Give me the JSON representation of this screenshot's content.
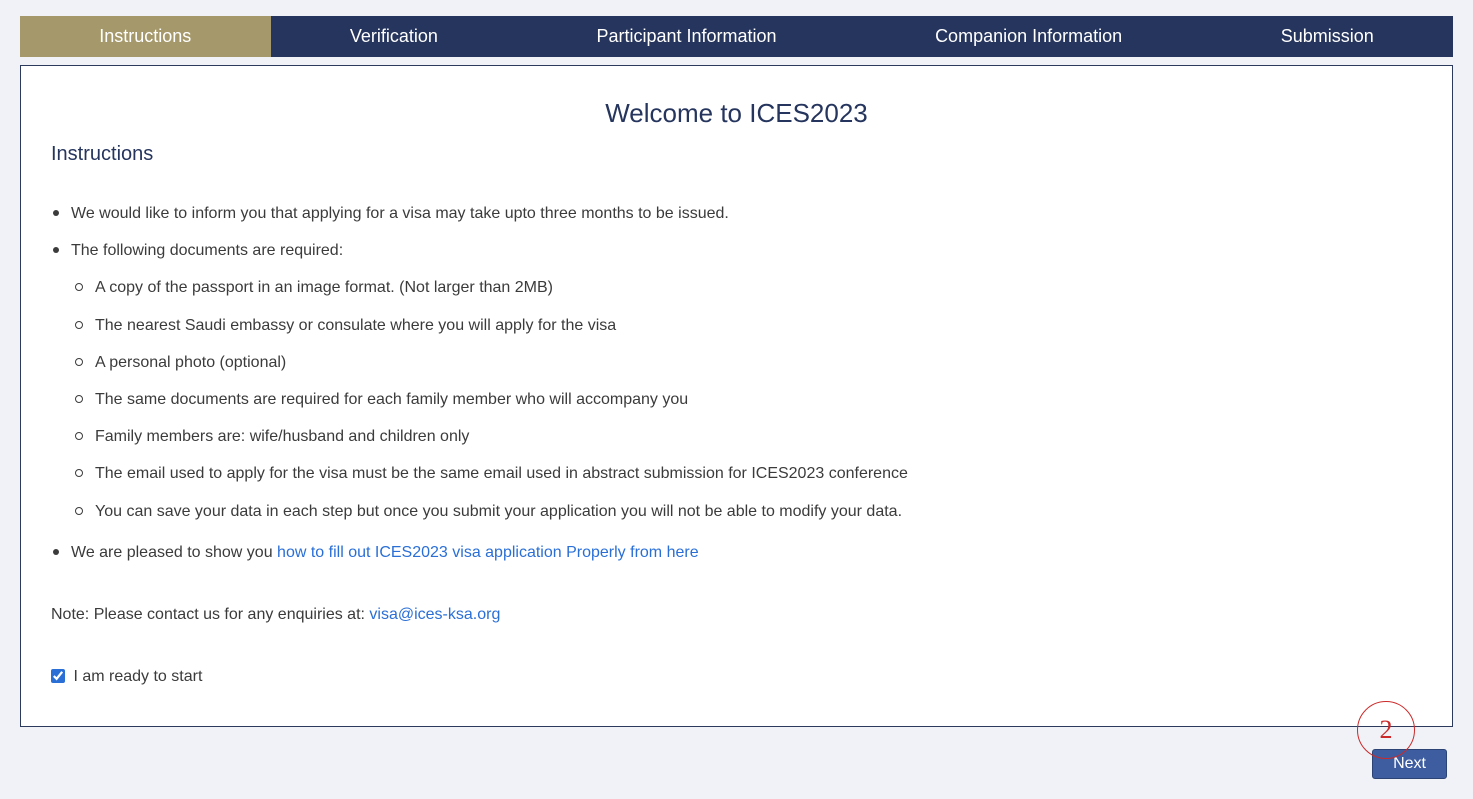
{
  "colors": {
    "navy": "#26355d",
    "gold": "#a5986a",
    "link": "#2a6fd6",
    "btn": "#3d5da0",
    "annotation": "#cc2a2a"
  },
  "tabs": [
    {
      "label": "Instructions",
      "active": true
    },
    {
      "label": "Verification",
      "active": false
    },
    {
      "label": "Participant Information",
      "active": false
    },
    {
      "label": "Companion Information",
      "active": false
    },
    {
      "label": "Submission",
      "active": false
    }
  ],
  "main": {
    "welcome_title": "Welcome to ICES2023",
    "section_title": "Instructions",
    "bullets": {
      "b1": "We would like to inform you that applying for a visa may take upto three months to be issued.",
      "b2": "The following documents are required:",
      "sub": {
        "s1": "A copy of the passport in an image format. (Not larger than 2MB)",
        "s2": "The nearest Saudi embassy or consulate where you will apply for the visa",
        "s3": "A personal photo (optional)",
        "s4": "The same documents are required for each family member who will accompany you",
        "s5": "Family members are: wife/husband and children only",
        "s6": "The email used to apply for the visa must be the same email used in abstract submission for ICES2023 conference",
        "s7": "You can save your data in each step but once you submit your application you will not be able to modify your data."
      },
      "b3_prefix": "We are pleased to show you ",
      "b3_link": "how to fill out ICES2023 visa application Properly from here"
    },
    "note_prefix": "Note: Please contact us for any enquiries at: ",
    "note_email": "visa@ices-ksa.org",
    "ready_label": " I am ready to start",
    "ready_checked": true
  },
  "footer": {
    "next_label": "Next"
  },
  "annotation": {
    "number": "2"
  }
}
